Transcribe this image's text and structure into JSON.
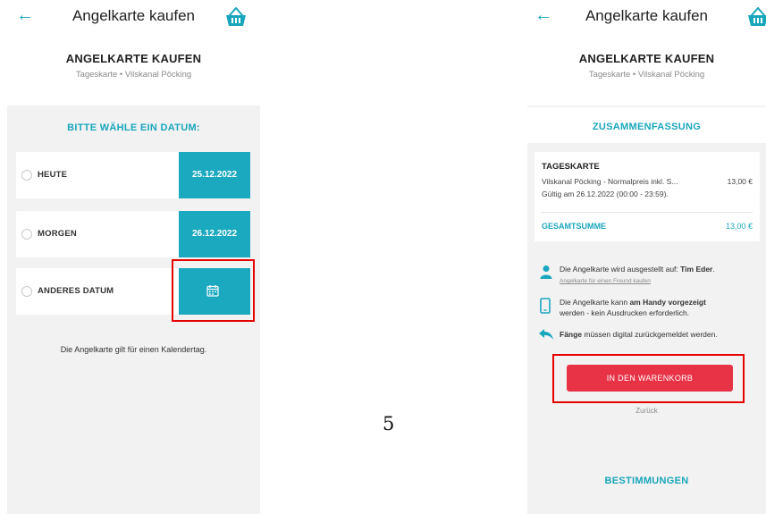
{
  "left_screen": {
    "header": {
      "back_icon": "arrow-left-icon",
      "title": "Angelkarte kaufen",
      "cart_icon": "basket-icon"
    },
    "title_block": {
      "title": "ANGELKARTE KAUFEN",
      "subtitle": "Tageskarte • Vilskanal Pöcking"
    },
    "date_prompt": "BITTE WÄHLE EIN DATUM:",
    "options": [
      {
        "label": "HEUTE",
        "date": "25.12.2022"
      },
      {
        "label": "MORGEN",
        "date": "26.12.2022"
      },
      {
        "label": "ANDERES DATUM",
        "date_icon": "calendar-icon"
      }
    ],
    "note": "Die Angelkarte gilt für einen Kalendertag."
  },
  "page_number": "5",
  "right_screen": {
    "header": {
      "back_icon": "arrow-left-icon",
      "title": "Angelkarte kaufen",
      "cart_icon": "basket-icon"
    },
    "title_block": {
      "title": "ANGELKARTE KAUFEN",
      "subtitle": "Tageskarte • Vilskanal Pöcking"
    },
    "summary_title": "ZUSAMMENFASSUNG",
    "summary": {
      "item_title": "TAGESKARTE",
      "item_line": "Vilskanal Pöcking - Normalpreis inkl. S...",
      "item_price": "13,00 €",
      "validity": "Gültig am 26.12.2022 (00:00 - 23:59).",
      "total_label": "GESAMTSUMME",
      "total_value": "13,00 €"
    },
    "info": {
      "issued_prefix": "Die Angelkarte wird ausgestellt auf: ",
      "issued_name": "Tim Eder",
      "issued_suffix": ".",
      "friend_link": "Angelkarte für einen Freund kaufen",
      "phone_prefix": "Die Angelkarte kann ",
      "phone_bold": "am Handy vorgezeigt",
      "phone_line2": "werden - kein Ausdrucken erforderlich.",
      "catch_bold": "Fänge",
      "catch_rest": " müssen digital zurückgemeldet werden."
    },
    "cart_button": "IN DEN WARENKORB",
    "back_link": "Zurück",
    "rules_link": "BESTIMMUNGEN"
  },
  "colors": {
    "accent": "#1ba9bf",
    "button": "#e83245",
    "highlight": "#e60000",
    "background": "#f2f2f2"
  }
}
